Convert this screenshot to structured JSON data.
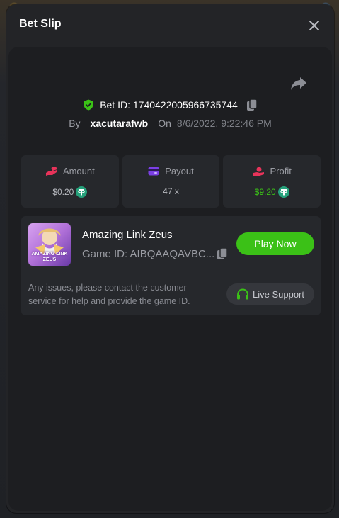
{
  "modal": {
    "title": "Bet Slip"
  },
  "bet": {
    "label": "Bet ID:",
    "id": "1740422005966735744",
    "by_label": "By",
    "user": "xacutarafwb",
    "on_label": "On",
    "date": "8/6/2022, 9:22:46 PM"
  },
  "stats": {
    "amount": {
      "label": "Amount",
      "value": "$0.20"
    },
    "payout": {
      "label": "Payout",
      "value": "47 x"
    },
    "profit": {
      "label": "Profit",
      "value": "$9.20"
    }
  },
  "game": {
    "name": "Amazing Link Zeus",
    "id_label": "Game ID:",
    "id_value": "AIBQAAQAVBC...",
    "thumb_text": "AMAZING LINK ZEUS",
    "play_label": "Play Now",
    "help_text": "Any issues, please contact the customer service for help and provide the game ID.",
    "support_label": "Live Support"
  },
  "colors": {
    "accent_green": "#3bc117",
    "amount_icon": "#e8335a",
    "payout_icon": "#7b3fe4",
    "profit_icon": "#e8335a",
    "coin": "#26a17b"
  },
  "icons": {
    "close": "close-icon",
    "share": "share-icon",
    "shield": "shield-check-icon",
    "copy": "copy-icon",
    "amount": "hand-bet-icon",
    "payout": "wallet-card-icon",
    "profit": "hand-coin-icon",
    "coin": "usdt-coin-icon",
    "support": "headset-icon"
  }
}
